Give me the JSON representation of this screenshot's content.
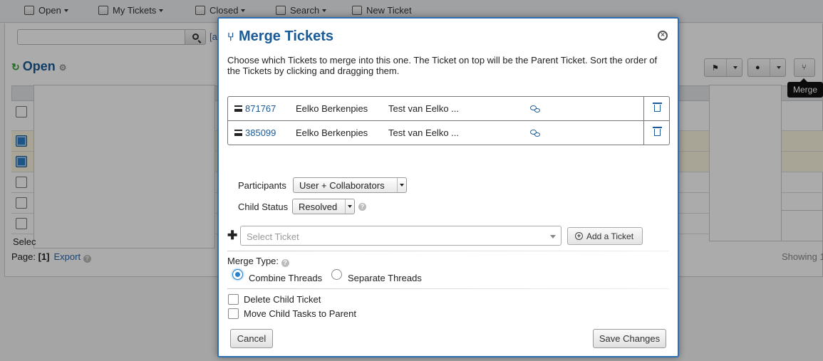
{
  "nav": {
    "items": [
      {
        "label": "Open",
        "caret": true
      },
      {
        "label": "My Tickets",
        "caret": true
      },
      {
        "label": "Closed",
        "caret": true
      },
      {
        "label": "Search",
        "caret": true
      },
      {
        "label": "New Ticket",
        "caret": false
      }
    ]
  },
  "queue": {
    "search_placeholder": "",
    "advanced_link": "[a",
    "title": "Open",
    "select_label": "Selec",
    "page_label": "Page:",
    "page_value": "[1]",
    "export_label": "Export",
    "showing": "Showing 1"
  },
  "tooltip": {
    "text": "Merge"
  },
  "modal": {
    "title": "Merge Tickets",
    "description": "Choose which Tickets to merge into this one. The Ticket on top will be the Parent Ticket. Sort the order of the Tickets by clicking and dragging them.",
    "tickets": [
      {
        "number": "871767",
        "name": "Eelko Berkenpies",
        "subject": "Test van Eelko ..."
      },
      {
        "number": "385099",
        "name": "Eelko Berkenpies",
        "subject": "Test van Eelko ..."
      }
    ],
    "participants_label": "Participants",
    "participants_value": "User + Collaborators",
    "child_status_label": "Child Status",
    "child_status_value": "Resolved",
    "select_ticket_placeholder": "Select Ticket",
    "add_ticket_label": "Add a Ticket",
    "merge_type_label": "Merge Type:",
    "combine_label": "Combine Threads",
    "separate_label": "Separate Threads",
    "delete_child_label": "Delete Child Ticket",
    "move_tasks_label": "Move Child Tasks to Parent",
    "cancel_label": "Cancel",
    "save_label": "Save Changes"
  },
  "colors": {
    "accent": "#1a5a96",
    "modal_border": "#2b6fb6"
  }
}
